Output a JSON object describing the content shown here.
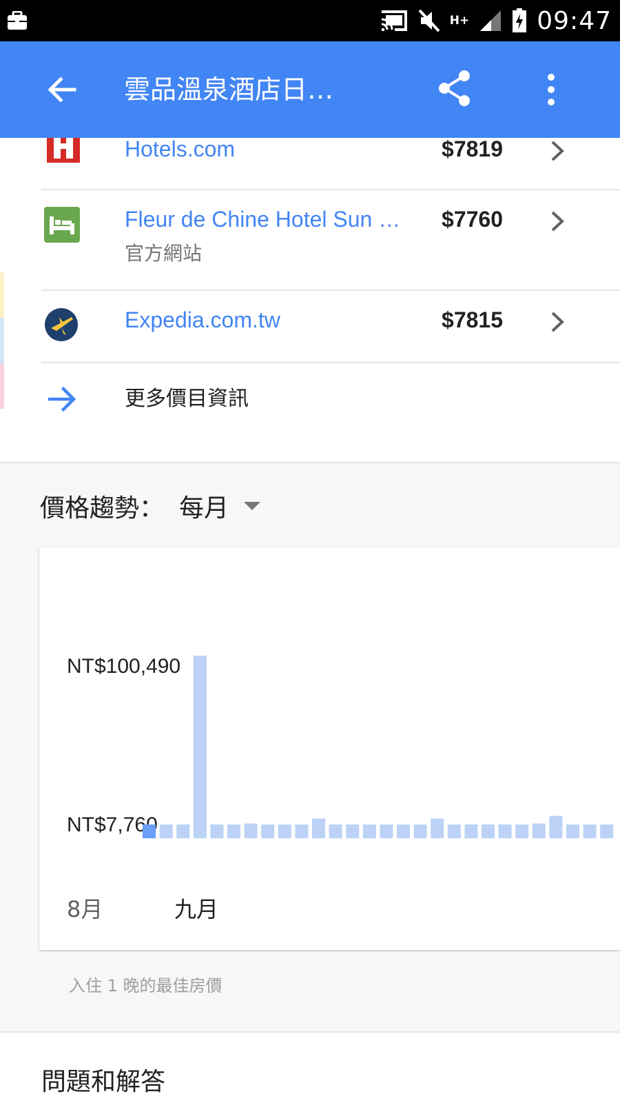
{
  "status_bar": {
    "time": "09:47",
    "network": "H+",
    "icons": [
      "briefcase-icon",
      "cast-icon",
      "mute-icon",
      "signal-icon",
      "battery-charging-icon"
    ]
  },
  "app_bar": {
    "title": "雲品溫泉酒店日…",
    "background": "#4285f4",
    "icons": [
      "back-arrow-icon",
      "share-icon",
      "more-vert-icon"
    ]
  },
  "price_list": [
    {
      "name": "Hotels.com",
      "subtitle": "",
      "price": "$7819",
      "icon": "hotels-com-logo"
    },
    {
      "name": "Fleur de Chine Hotel Sun …",
      "subtitle": "官方網站",
      "price": "$7760",
      "icon": "hotel-bed-icon"
    },
    {
      "name": "Expedia.com.tw",
      "subtitle": "",
      "price": "$7815",
      "icon": "expedia-logo"
    }
  ],
  "more_prices_label": "更多價目資訊",
  "price_trend": {
    "title": "價格趨勢：",
    "period": "每月",
    "note": "入住 1 晚的最佳房價"
  },
  "chart_data": {
    "type": "bar",
    "y_axis_labels": [
      "NT$100,490",
      "NT$7,760"
    ],
    "ylim": [
      7760,
      100490
    ],
    "x_labels": [
      "8月",
      "九月"
    ],
    "values": [
      7760,
      7760,
      7760,
      100490,
      7760,
      7760,
      8300,
      7760,
      7760,
      7760,
      11000,
      7760,
      7760,
      7760,
      7760,
      7760,
      7760,
      11000,
      7760,
      7760,
      7760,
      7760,
      7760,
      8300,
      12500,
      7760,
      7760,
      7760
    ],
    "selected_index": 0,
    "colors": {
      "bar": "#bcd2f7",
      "selected": "#6c9ef8"
    }
  },
  "qa_title": "問題和解答"
}
